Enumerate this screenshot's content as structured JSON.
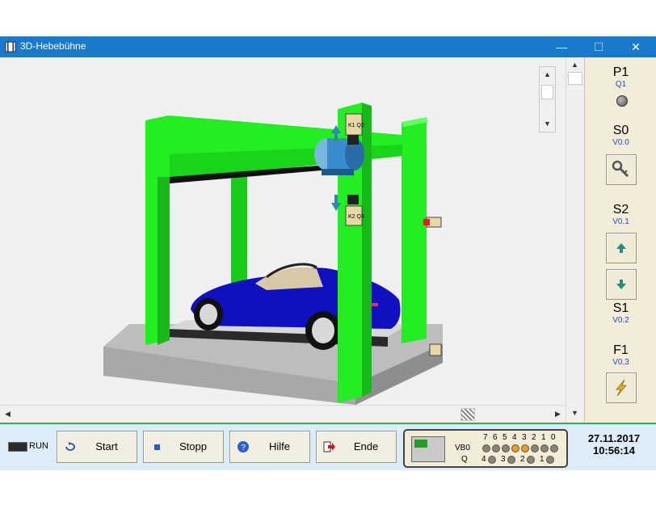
{
  "window": {
    "title": "3D-Hebebühne",
    "controls": {
      "minimize": "—",
      "maximize": "☐",
      "close": "✕"
    }
  },
  "right_panel": {
    "p1": {
      "name": "P1",
      "addr": "Q1"
    },
    "s0": {
      "name": "S0",
      "addr": "V0.0",
      "icon": "key-icon"
    },
    "s2": {
      "name": "S2",
      "addr": "V0.1",
      "icon": "arrow-up-icon"
    },
    "down_icon": "arrow-down-icon",
    "s1": {
      "name": "S1",
      "addr": "V0.2"
    },
    "f1": {
      "name": "F1",
      "addr": "V0.3",
      "icon": "lightning-icon"
    }
  },
  "scene_labels": {
    "top_switch": "K1 Q2",
    "bottom_switch": "K2 Q3"
  },
  "bottom": {
    "run_label": "RUN",
    "buttons": [
      {
        "label": "Start",
        "icon": "cycle-icon"
      },
      {
        "label": "Stopp",
        "icon": "stop-square-icon"
      },
      {
        "label": "Hilfe",
        "icon": "help-icon"
      },
      {
        "label": "Ende",
        "icon": "exit-arrow-icon"
      }
    ],
    "plc": {
      "bit_header": [
        "7",
        "6",
        "5",
        "4",
        "3",
        "2",
        "1",
        "0"
      ],
      "vb0_label": "VB0",
      "vb0_states": [
        0,
        0,
        0,
        1,
        1,
        0,
        0,
        0
      ],
      "q_label": "Q",
      "q_bits": [
        "4",
        "3",
        "2",
        "1"
      ]
    },
    "date": "27.11.2017",
    "time": "10:56:14"
  },
  "colors": {
    "lift_green": "#22ee22",
    "car_blue": "#1010c0",
    "titlebar": "#1979ca",
    "accent_border": "#30b050"
  }
}
